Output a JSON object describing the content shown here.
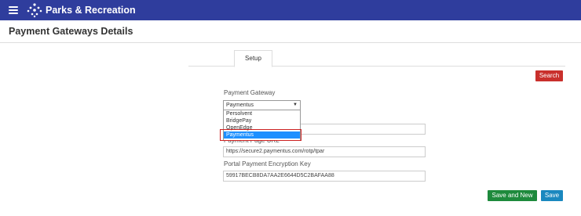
{
  "app": {
    "title": "Parks & Recreation"
  },
  "page": {
    "title": "Payment Gateways Details"
  },
  "tabs": [
    {
      "label": "Setup"
    }
  ],
  "buttons": {
    "search": "Search",
    "save_and_new": "Save and New",
    "save": "Save"
  },
  "payment_gateway": {
    "label": "Payment Gateway",
    "selected": "Paymentus",
    "options": [
      "Persolvent",
      "BridgePay",
      "OpenEdge",
      "Paymentus"
    ]
  },
  "payment_page_url": {
    "label": "Payment Page URL",
    "value": "https://secure2.paymentus.com/rotp/tpar"
  },
  "encryption_key": {
    "label": "Portal Payment Encryption Key",
    "value": "59917BECB8DA7AA2E6644D5C2BAFAA88"
  },
  "colors": {
    "topbar": "#2f3d9d",
    "search": "#c9302c",
    "save_and_new": "#1e8a3c",
    "save": "#1a88bf",
    "selected_option": "#1e90ff"
  }
}
